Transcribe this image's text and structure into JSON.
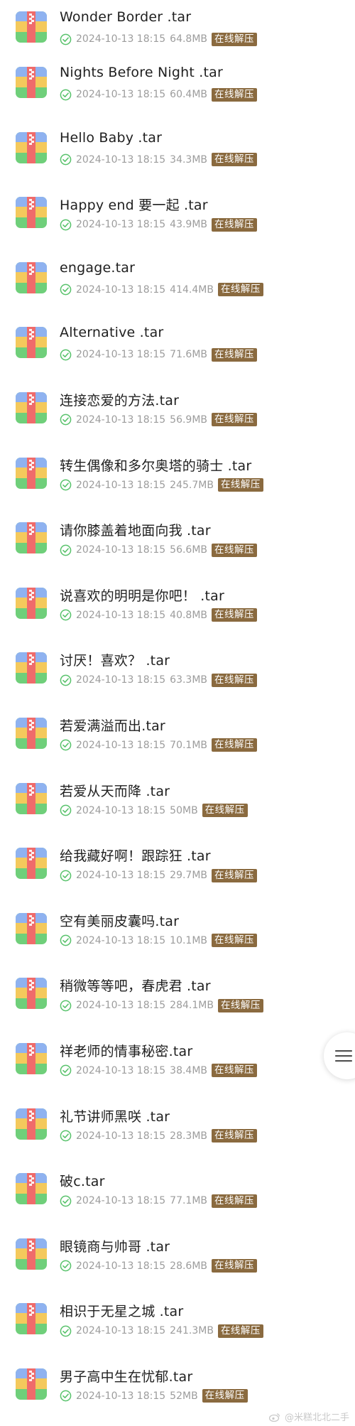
{
  "files": [
    {
      "name": "Wonder Border .tar",
      "date": "2024-10-13 18:15",
      "size": "64.8MB",
      "action": "在线解压"
    },
    {
      "name": "Nights Before Night .tar",
      "date": "2024-10-13 18:15",
      "size": "60.4MB",
      "action": "在线解压"
    },
    {
      "name": "Hello Baby .tar",
      "date": "2024-10-13 18:15",
      "size": "34.3MB",
      "action": "在线解压"
    },
    {
      "name": "Happy end 要一起 .tar",
      "date": "2024-10-13 18:15",
      "size": "43.9MB",
      "action": "在线解压"
    },
    {
      "name": "engage.tar",
      "date": "2024-10-13 18:15",
      "size": "414.4MB",
      "action": "在线解压"
    },
    {
      "name": "Alternative .tar",
      "date": "2024-10-13 18:15",
      "size": "71.6MB",
      "action": "在线解压"
    },
    {
      "name": "连接恋爱的方法.tar",
      "date": "2024-10-13 18:15",
      "size": "56.9MB",
      "action": "在线解压"
    },
    {
      "name": "转生偶像和多尔奥塔的骑士 .tar",
      "date": "2024-10-13 18:15",
      "size": "245.7MB",
      "action": "在线解压"
    },
    {
      "name": "请你膝盖着地面向我 .tar",
      "date": "2024-10-13 18:15",
      "size": "56.6MB",
      "action": "在线解压"
    },
    {
      "name": "说喜欢的明明是你吧！ .tar",
      "date": "2024-10-13 18:15",
      "size": "40.8MB",
      "action": "在线解压"
    },
    {
      "name": "讨厌！喜欢？ .tar",
      "date": "2024-10-13 18:15",
      "size": "63.3MB",
      "action": "在线解压"
    },
    {
      "name": "若爱满溢而出.tar",
      "date": "2024-10-13 18:15",
      "size": "70.1MB",
      "action": "在线解压"
    },
    {
      "name": "若爱从天而降 .tar",
      "date": "2024-10-13 18:15",
      "size": "50MB",
      "action": "在线解压"
    },
    {
      "name": "给我藏好啊！跟踪狂 .tar",
      "date": "2024-10-13 18:15",
      "size": "29.7MB",
      "action": "在线解压"
    },
    {
      "name": "空有美丽皮囊吗.tar",
      "date": "2024-10-13 18:15",
      "size": "10.1MB",
      "action": "在线解压"
    },
    {
      "name": "稍微等等吧，春虎君 .tar",
      "date": "2024-10-13 18:15",
      "size": "284.1MB",
      "action": "在线解压"
    },
    {
      "name": "祥老师的情事秘密.tar",
      "date": "2024-10-13 18:15",
      "size": "38.4MB",
      "action": "在线解压"
    },
    {
      "name": "礼节讲师黑咲 .tar",
      "date": "2024-10-13 18:15",
      "size": "28.3MB",
      "action": "在线解压"
    },
    {
      "name": "破c.tar",
      "date": "2024-10-13 18:15",
      "size": "77.1MB",
      "action": "在线解压"
    },
    {
      "name": "眼镜商与帅哥 .tar",
      "date": "2024-10-13 18:15",
      "size": "28.6MB",
      "action": "在线解压"
    },
    {
      "name": "相识于无星之城 .tar",
      "date": "2024-10-13 18:15",
      "size": "241.3MB",
      "action": "在线解压"
    },
    {
      "name": "男子高中生在忧郁.tar",
      "date": "2024-10-13 18:15",
      "size": "52MB",
      "action": "在线解压"
    }
  ],
  "watermark": "@米糕北北二手",
  "icons": {
    "file": "archive-file-icon",
    "status": "check-circle-icon",
    "menu": "menu-icon",
    "watermark": "weibo-icon"
  },
  "colors": {
    "button_bg": "#8a6a3f",
    "check": "#58c26b",
    "archive_blue": "#8fb2f0",
    "archive_yellow": "#f4c95c",
    "archive_green": "#6fcf7a",
    "archive_red": "#ef6b6b"
  }
}
